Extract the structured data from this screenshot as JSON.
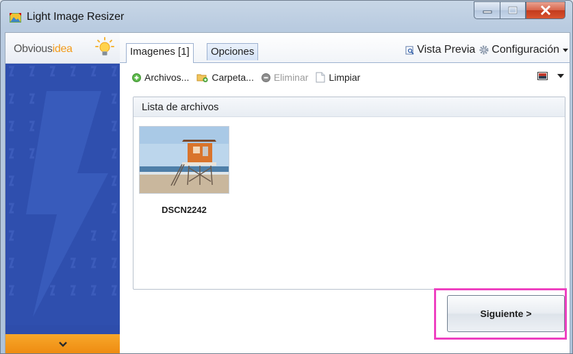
{
  "window": {
    "title": "Light Image Resizer",
    "buttons": [
      "minimize",
      "maximize",
      "close"
    ]
  },
  "sidebar": {
    "logo_text_plain": "Obvious",
    "logo_text_accent": "idea",
    "bottom_icon": "chevron-down-icon"
  },
  "tabs": [
    {
      "label": "Imagenes [1]",
      "active": true
    },
    {
      "label": "Opciones",
      "active": false
    }
  ],
  "header_links": {
    "preview": "Vista Previa",
    "settings": "Configuración"
  },
  "toolbar": {
    "files": "Archivos...",
    "folder": "Carpeta...",
    "remove": "Eliminar",
    "clear": "Limpiar"
  },
  "file_list": {
    "header": "Lista de archivos",
    "items": [
      {
        "name": "DSCN2242"
      }
    ]
  },
  "next_button": {
    "label": "Siguiente >"
  },
  "colors": {
    "sidebar_blue": "#2e4dab",
    "accent_orange": "#f39a18",
    "highlight_pink": "#ee3fc0"
  }
}
